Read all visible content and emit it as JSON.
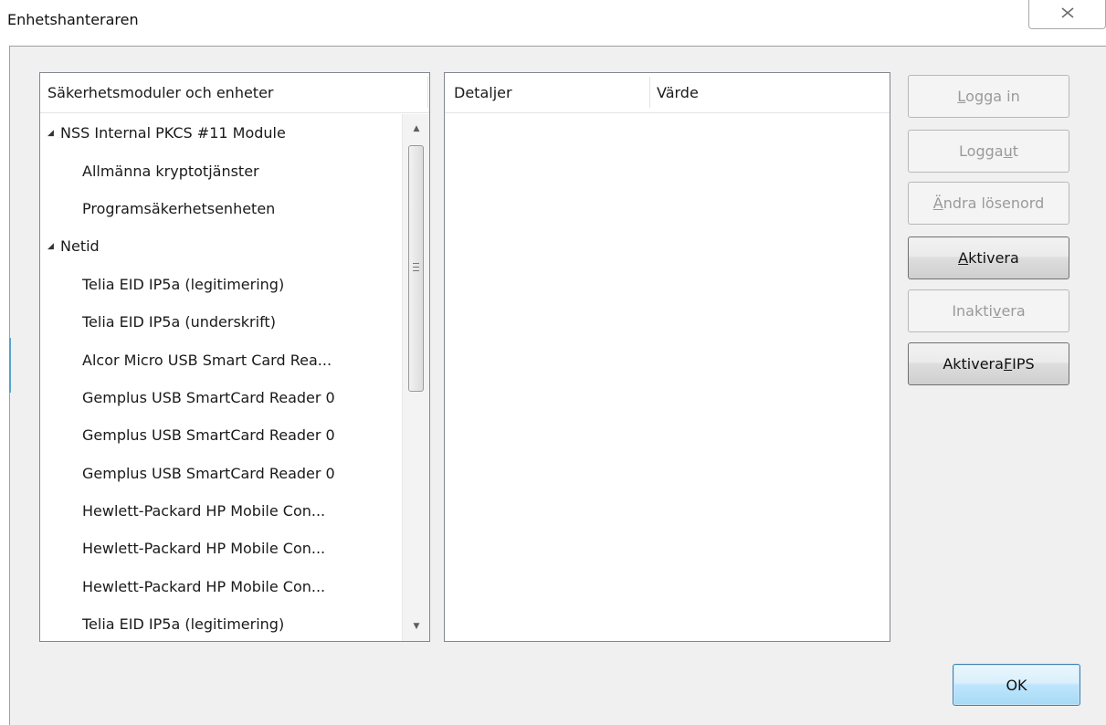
{
  "window": {
    "title": "Enhetshanteraren",
    "close_glyph": "☒"
  },
  "tree": {
    "header": "Säkerhetsmoduler och enheter",
    "rows": [
      {
        "label": "NSS Internal PKCS #11 Module",
        "twisty": "◢"
      },
      {
        "label": "Allmänna kryptotjänster"
      },
      {
        "label": "Programsäkerhetsenheten"
      },
      {
        "label": "Netid",
        "twisty": "◢"
      },
      {
        "label": "Telia EID IP5a (legitimering)"
      },
      {
        "label": "Telia EID IP5a (underskrift)"
      },
      {
        "label": "Alcor Micro USB Smart Card Rea..."
      },
      {
        "label": "Gemplus USB SmartCard Reader 0"
      },
      {
        "label": "Gemplus USB SmartCard Reader 0"
      },
      {
        "label": "Gemplus USB SmartCard Reader 0"
      },
      {
        "label": "Hewlett-Packard HP Mobile Con..."
      },
      {
        "label": "Hewlett-Packard HP Mobile Con..."
      },
      {
        "label": "Hewlett-Packard HP Mobile Con..."
      },
      {
        "label": "Telia EID IP5a (legitimering)"
      }
    ],
    "scroll": {
      "up_glyph": "▲",
      "down_glyph": "▼"
    }
  },
  "details": {
    "col1": "Detaljer",
    "col2": "Värde"
  },
  "buttons": {
    "login": {
      "pre": "",
      "u": "L",
      "post": "ogga in"
    },
    "logout": {
      "pre": "Logga ",
      "u": "u",
      "post": "t"
    },
    "change_password": {
      "pre": "",
      "u": "Ä",
      "post": "ndra lösenord"
    },
    "enable": {
      "pre": "",
      "u": "A",
      "post": "ktivera"
    },
    "disable": {
      "pre": "Inakti",
      "u": "v",
      "post": "era"
    },
    "enable_fips": {
      "pre": "Aktivera ",
      "u": "F",
      "post": "IPS"
    },
    "ok": "OK"
  }
}
